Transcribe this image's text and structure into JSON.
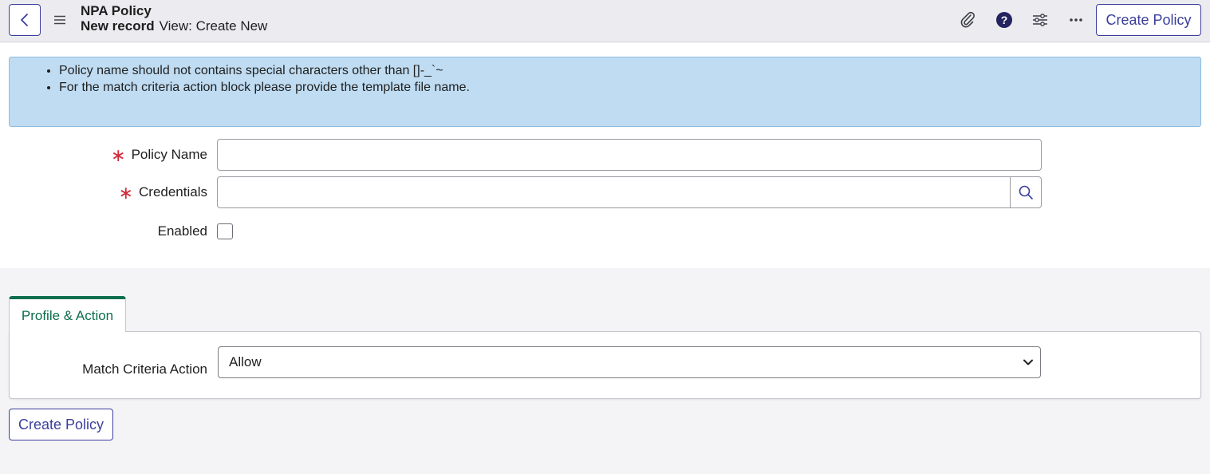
{
  "header": {
    "back_icon": "chevron-left-icon",
    "menu_icon": "hamburger-icon",
    "title": "NPA Policy",
    "record": "New record",
    "view": "View: Create New",
    "icons": [
      "paperclip-icon",
      "help-icon",
      "settings-sliders-icon",
      "more-icon"
    ],
    "create_label": "Create Policy",
    "accent_color": "#3b3f9c"
  },
  "info": {
    "items": [
      "Policy name should not contains special characters other than []-_`~",
      "For the match criteria action block please provide the template file name."
    ],
    "background_color": "#bfdcf2"
  },
  "form": {
    "policy_name_label": "Policy Name",
    "policy_name_value": "",
    "credentials_label": "Credentials",
    "credentials_value": "",
    "enabled_label": "Enabled",
    "enabled_checked": false,
    "required_color": "#d42a3c"
  },
  "tabs": [
    {
      "label": "Profile & Action",
      "active": true,
      "color": "#0d6e4f"
    }
  ],
  "profile": {
    "match_criteria_label": "Match Criteria Action",
    "match_criteria_value": "Allow"
  },
  "footer": {
    "create_label": "Create Policy"
  }
}
